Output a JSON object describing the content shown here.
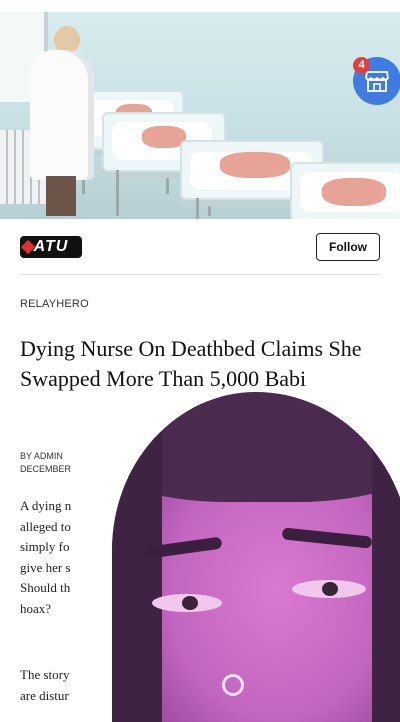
{
  "header": {
    "logo_text": "ATU",
    "follow_label": "Follow"
  },
  "cart_badge": {
    "count": "4",
    "icon": "store-icon"
  },
  "article": {
    "source": "RELAYHERO",
    "title": "Dying Nurse On Deathbed Claims She Swapped More Than 5,000 Babi",
    "author": "BY ADMIN",
    "date": "DECEMBER",
    "body_lines": [
      "A dying n",
      "alleged to",
      "simply fo",
      "give her s",
      "Should th",
      "hoax?"
    ],
    "body_lines_2": [
      "The story",
      "are distur"
    ]
  },
  "colors": {
    "accent_blue": "#3f7be0",
    "badge_red": "#e0403e",
    "logo_red": "#e03131"
  }
}
